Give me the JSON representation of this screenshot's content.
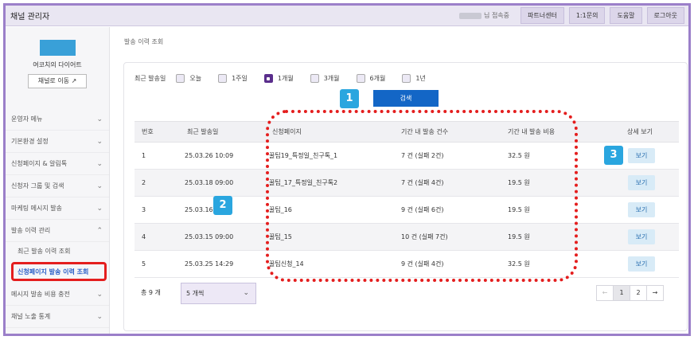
{
  "topbar": {
    "title": "채널 관리자",
    "status_text": "님 접속중",
    "buttons": [
      "파트너센터",
      "1:1문의",
      "도움말",
      "로그아웃"
    ]
  },
  "sidebar": {
    "brand_name": "여코치의 다이어트",
    "move_button": "채널로 이동 ↗",
    "menu": [
      {
        "label": "운영자 메뉴",
        "chevron": "⌄"
      },
      {
        "label": "기본환경 설정",
        "chevron": "⌄"
      },
      {
        "label": "신청페이지 & 알림톡",
        "chevron": "⌄"
      },
      {
        "label": "신청자 그룹 및 검색",
        "chevron": "⌄"
      },
      {
        "label": "마케팅 메시지 발송",
        "chevron": "⌄"
      },
      {
        "label": "발송 이력 관리",
        "chevron": "⌃"
      }
    ],
    "submenu": [
      "최근 발송 이력 조회",
      "신청페이지 발송 이력 조회"
    ],
    "menu_bottom": [
      {
        "label": "메시지 발송 비용 충전",
        "chevron": "⌄"
      },
      {
        "label": "채널 노출 통계",
        "chevron": "⌄"
      }
    ]
  },
  "breadcrumb": "발송 이력 조회",
  "filters": {
    "label": "최근 발송일",
    "options": [
      {
        "label": "오늘",
        "checked": false
      },
      {
        "label": "1주일",
        "checked": false
      },
      {
        "label": "1개월",
        "checked": true
      },
      {
        "label": "3개월",
        "checked": false
      },
      {
        "label": "6개월",
        "checked": false
      },
      {
        "label": "1년",
        "checked": false
      }
    ],
    "search_label": "검색"
  },
  "badges": {
    "b1": "1",
    "b2": "2",
    "b3": "3"
  },
  "table": {
    "headers": [
      "번호",
      "최근 발송일",
      "신청페이지",
      "기간 내 발송 건수",
      "기간 내 발송 비용",
      "상세 보기"
    ],
    "view_label": "보기",
    "rows": [
      {
        "no": "1",
        "date": "25.03.26 10:09",
        "page": "꿀팁19_특정일_친구톡_1",
        "count": "7 건 (실패 2건)",
        "cost": "32.5 원"
      },
      {
        "no": "2",
        "date": "25.03.18 09:00",
        "page": "꿀팁_17_특정일_친구톡2",
        "count": "7 건 (실패 4건)",
        "cost": "19.5 원"
      },
      {
        "no": "3",
        "date": "25.03.16",
        "page": "꿀팁_16",
        "count": "9 건 (실패 6건)",
        "cost": "19.5 원"
      },
      {
        "no": "4",
        "date": "25.03.15 09:00",
        "page": "꿀팁_15",
        "count": "10 건 (실패 7건)",
        "cost": "19.5 원"
      },
      {
        "no": "5",
        "date": "25.03.25 14:29",
        "page": "꿀팁신청_14",
        "count": "9 건 (실패 4건)",
        "cost": "32.5 원"
      }
    ]
  },
  "footer": {
    "total": "총 9 개",
    "page_size": "5 개씩",
    "pages": [
      "←",
      "1",
      "2",
      "→"
    ]
  },
  "colors": {
    "accent": "#5a2e8c",
    "primary_button": "#1366c6",
    "highlight": "#e41e1e",
    "badge": "#2aa6df"
  }
}
